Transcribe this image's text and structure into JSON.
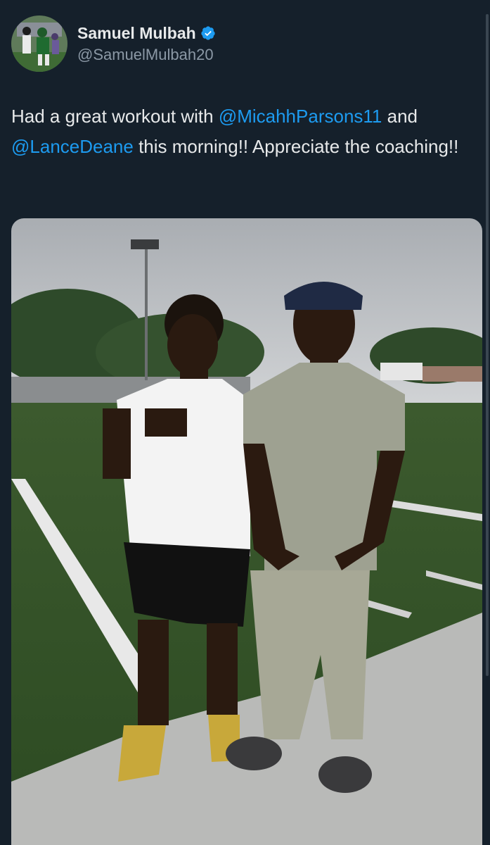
{
  "author": {
    "display_name": "Samuel Mulbah",
    "handle": "@SamuelMulbah20",
    "verified": true,
    "avatar_icon": "profile-photo-football-player"
  },
  "tweet": {
    "segments": [
      {
        "text": "Had a great workout with ",
        "type": "text"
      },
      {
        "text": "@MicahhParsons11",
        "type": "mention"
      },
      {
        "text": " and ",
        "type": "text"
      },
      {
        "text": "@LanceDeane",
        "type": "mention"
      },
      {
        "text": " this morning!! Appreciate the coaching!!",
        "type": "text"
      }
    ]
  },
  "media": {
    "type": "photo",
    "icon": "photo-two-athletes-on-football-field"
  },
  "colors": {
    "background": "#15202b",
    "text": "#e7e9ea",
    "secondary_text": "#8b98a5",
    "link": "#1d9bf0",
    "verified_badge": "#1d9bf0"
  }
}
